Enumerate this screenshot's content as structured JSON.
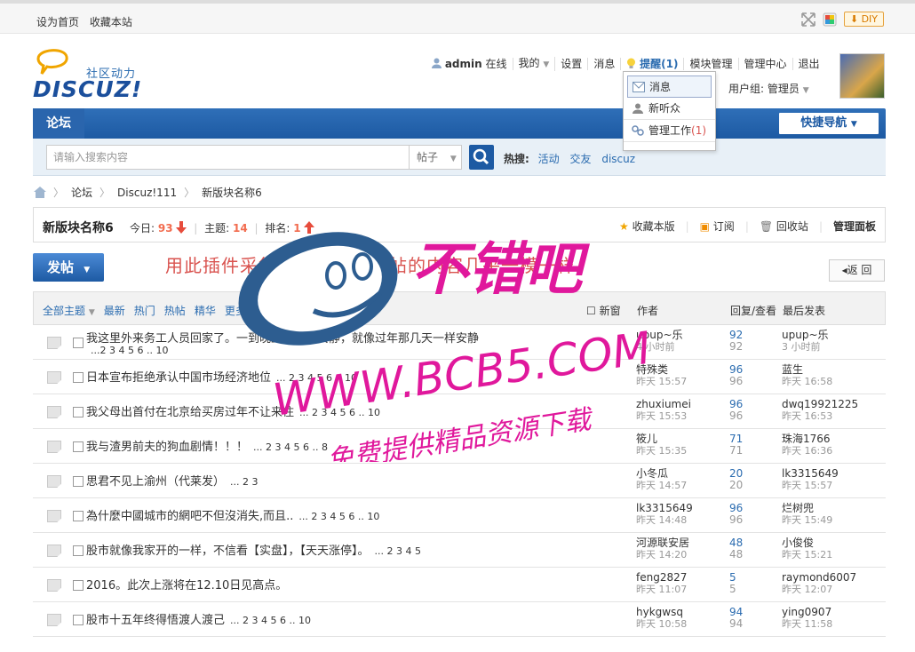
{
  "topbar": {
    "set_home": "设为首页",
    "bookmark": "收藏本站",
    "diy": "DIY"
  },
  "brand": {
    "sub": "社区动力",
    "name": "DISCUZ!"
  },
  "user_menu": {
    "username": "admin",
    "online": "在线",
    "mine": "我的",
    "settings": "设置",
    "messages": "消息",
    "remind": "提醒(1)",
    "module_manage": "模块管理",
    "admin_center": "管理中心",
    "logout": "退出",
    "group": "用户组: 管理员"
  },
  "popup": {
    "messages": "消息",
    "new_listener": "新听众",
    "manage_work": "管理工作",
    "manage_count": "(1)"
  },
  "nav": {
    "forum_tab": "论坛",
    "quick_nav": "快捷导航"
  },
  "search": {
    "placeholder": "请输入搜索内容",
    "type": "帖子",
    "hot_label": "热搜:",
    "hot": [
      "活动",
      "交友",
      "discuz"
    ]
  },
  "breadcrumb": [
    "论坛",
    "Discuz!111",
    "新版块名称6"
  ],
  "forum": {
    "name": "新版块名称6",
    "today_label": "今日:",
    "today": "93",
    "topics_label": "主题:",
    "topics": "14",
    "rank_label": "排名:",
    "rank": "1",
    "actions": [
      "收藏本版",
      "订阅",
      "回收站",
      "管理面板"
    ]
  },
  "post_button": "发帖",
  "notice": "用此插件采集的内容，真实帖的内容几乎一模一样。",
  "back_button": "返 回",
  "thread_head": {
    "filters": [
      "全部主题",
      "最新",
      "热门",
      "热帖",
      "精华",
      "更多"
    ],
    "newwin": "新窗",
    "author": "作者",
    "replies": "回复/查看",
    "last": "最后发表"
  },
  "threads": [
    {
      "title": "我这里外来务工人员回家了。一到晚上街上很安静，就像过年那几天一样安静",
      "pages": "...2 3 4 5 6 .. 10",
      "two": true,
      "author": "upup~乐",
      "author_time": "4 小时前",
      "replies": "92",
      "views": "92",
      "last_user": "upup~乐",
      "last_time": "3 小时前"
    },
    {
      "title": "日本宣布拒绝承认中国市场经济地位",
      "pages": "... 2 3 4 5 6 .. 10",
      "two": false,
      "author": "特殊类",
      "author_time": "昨天 15:57",
      "replies": "96",
      "views": "96",
      "last_user": "蓝生",
      "last_time": "昨天 16:58"
    },
    {
      "title": "我父母出首付在北京给买房过年不让来住",
      "pages": "... 2 3 4 5 6 .. 10",
      "two": false,
      "author": "zhuxiumei",
      "author_time": "昨天 15:53",
      "replies": "96",
      "views": "96",
      "last_user": "dwq19921225",
      "last_time": "昨天 16:53"
    },
    {
      "title": "我与渣男前夫的狗血剧情！！！",
      "pages": "... 2 3 4 5 6 .. 8",
      "two": false,
      "author": "筱儿",
      "author_time": "昨天 15:35",
      "replies": "71",
      "views": "71",
      "last_user": "珠海1766",
      "last_time": "昨天 16:36"
    },
    {
      "title": "思君不见上渝州（代莱发）",
      "pages": "... 2 3",
      "two": false,
      "author": "小冬瓜",
      "author_time": "昨天 14:57",
      "replies": "20",
      "views": "20",
      "last_user": "lk3315649",
      "last_time": "昨天 15:57"
    },
    {
      "title": "為什麼中國城市的網吧不但沒消失,而且..",
      "pages": "... 2 3 4 5 6 .. 10",
      "two": false,
      "author": "lk3315649",
      "author_time": "昨天 14:48",
      "replies": "96",
      "views": "96",
      "last_user": "烂树兜",
      "last_time": "昨天 15:49"
    },
    {
      "title": "股市就像我家开的一样，不信看【实盘】，【天天涨停】。",
      "pages": "... 2 3 4 5",
      "two": false,
      "author": "河源联安居",
      "author_time": "昨天 14:20",
      "replies": "48",
      "views": "48",
      "last_user": "小俊俊",
      "last_time": "昨天 15:21"
    },
    {
      "title": "2016。此次上涨将在12.10日见高点。",
      "pages": "",
      "two": false,
      "author": "feng2827",
      "author_time": "昨天 11:07",
      "replies": "5",
      "views": "5",
      "last_user": "raymond6007",
      "last_time": "昨天 12:07"
    },
    {
      "title": "股市十五年终得悟渡人渡己",
      "pages": "... 2 3 4 5 6 .. 10",
      "two": false,
      "author": "hykgwsq",
      "author_time": "昨天 10:58",
      "replies": "94",
      "views": "94",
      "last_user": "ying0907",
      "last_time": "昨天 11:58"
    }
  ],
  "watermark": {
    "line1": "不错吧",
    "line2": "WWW.BCB5.COM",
    "line3": "免费提供精品资源下载"
  },
  "colors": {
    "primary": "#1d5aa3",
    "accent_red": "#d9534f",
    "watermark": "#e0189c"
  }
}
